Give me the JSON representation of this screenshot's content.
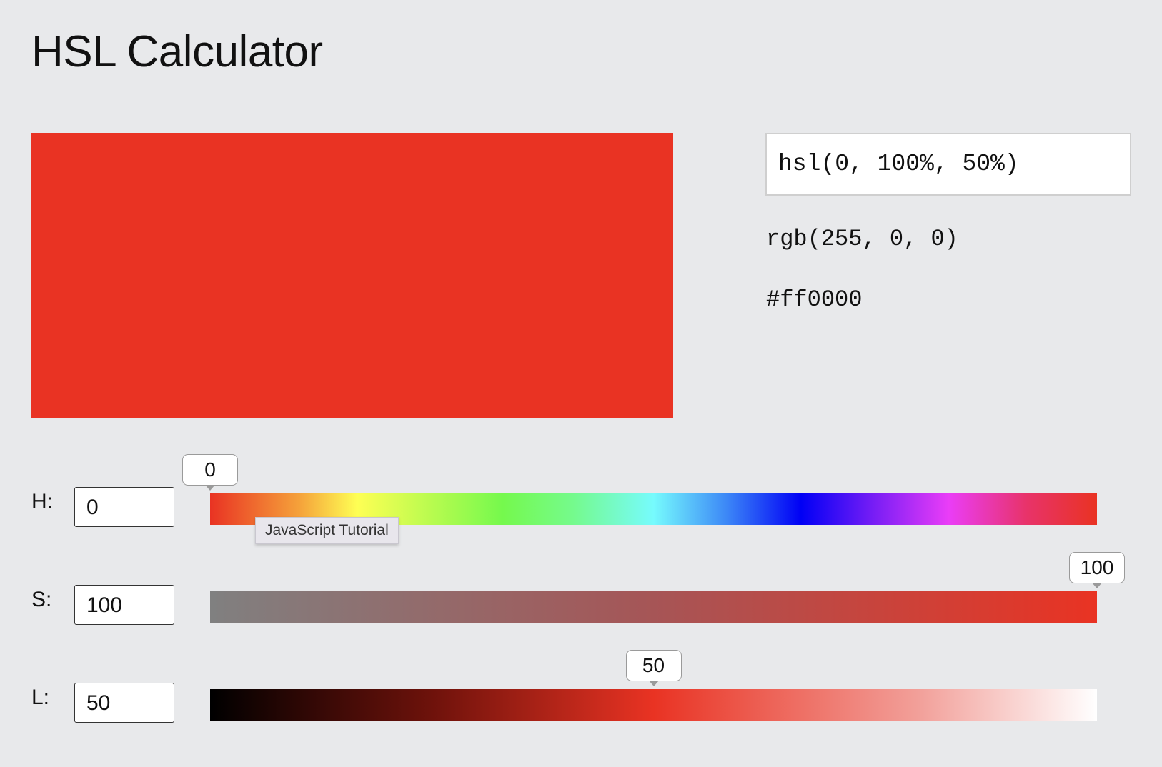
{
  "page": {
    "title": "HSL Calculator"
  },
  "color": {
    "swatch_hex": "#e93323",
    "hsl_text": "hsl(0, 100%, 50%)",
    "rgb_text": "rgb(255, 0, 0)",
    "hex_text": "#ff0000"
  },
  "controls": {
    "hue": {
      "label": "H:",
      "value": "0",
      "slider_value": "0",
      "min": 0,
      "max": 360
    },
    "saturation": {
      "label": "S:",
      "value": "100",
      "slider_value": "100",
      "min": 0,
      "max": 100
    },
    "lightness": {
      "label": "L:",
      "value": "50",
      "slider_value": "50",
      "min": 0,
      "max": 100
    }
  },
  "tooltip": {
    "text": "JavaScript Tutorial"
  }
}
